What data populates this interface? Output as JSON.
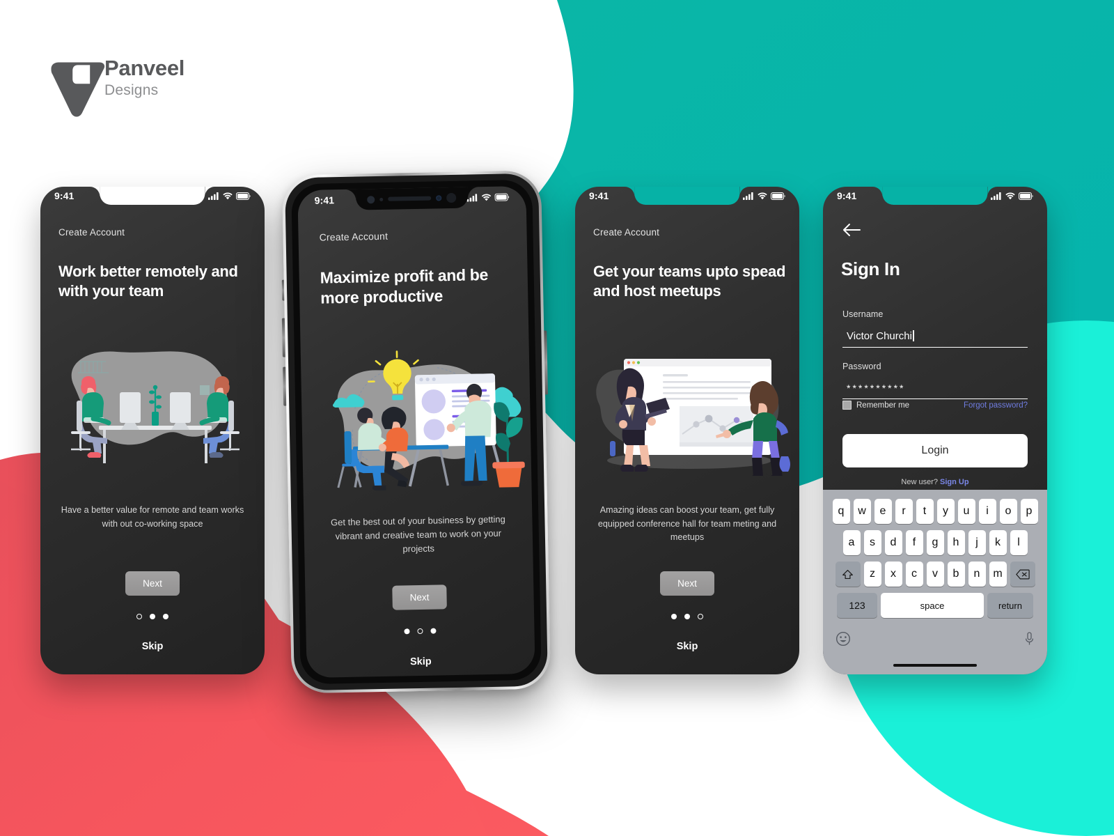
{
  "brand": {
    "name": "Panveel",
    "tagline": "Designs",
    "logo_icon": "triangle-logo-icon"
  },
  "palette": {
    "teal": "#06b2a6",
    "cyan": "#1af0d8",
    "coral": "#f5545c",
    "white": "#ffffff",
    "screen_dark": "#2f2f2f",
    "accent_link": "#6f7ce0",
    "keyboard_bg": "#abaeb4"
  },
  "status_bar": {
    "time": "9:41",
    "cellular_icon": "cellular-signal-icon",
    "wifi_icon": "wifi-icon",
    "battery_icon": "battery-icon"
  },
  "onboarding": [
    {
      "id": "screen-1",
      "eyebrow": "Create Account",
      "headline": "Work better remotely and with your team",
      "caption": "Have a better value for remote and team works with out co-working space",
      "next_label": "Next",
      "skip_label": "Skip",
      "active_dot": 0,
      "illustration": "two-people-at-desks-illustration"
    },
    {
      "id": "screen-2",
      "eyebrow": "Create Account",
      "headline": "Maximize profit and be more productive",
      "caption": "Get the best out of your business by getting vibrant and creative team to work on your projects",
      "next_label": "Next",
      "skip_label": "Skip",
      "active_dot": 1,
      "illustration": "team-presentation-whiteboard-illustration"
    },
    {
      "id": "screen-3",
      "eyebrow": "Create Account",
      "headline": "Get your teams upto spead and host meetups",
      "caption": "Amazing ideas can boost your team, get fully equipped conference hall for team meting and meetups",
      "next_label": "Next",
      "skip_label": "Skip",
      "active_dot": 2,
      "illustration": "conference-presentation-illustration"
    }
  ],
  "signin": {
    "back_icon": "back-arrow-icon",
    "title": "Sign In",
    "username_label": "Username",
    "username_value": "Victor Churchi",
    "username_placeholder": "Username",
    "password_label": "Password",
    "password_value": "**********",
    "password_placeholder": "Password",
    "remember_label": "Remember me",
    "remember_checked": false,
    "forgot_label": "Forgot password?",
    "login_label": "Login",
    "newuser_prefix": "New user? ",
    "signup_label": "Sign Up"
  },
  "keyboard": {
    "row1": [
      "q",
      "w",
      "e",
      "r",
      "t",
      "y",
      "u",
      "i",
      "o",
      "p"
    ],
    "row2": [
      "a",
      "s",
      "d",
      "f",
      "g",
      "h",
      "j",
      "k",
      "l"
    ],
    "row3": [
      "z",
      "x",
      "c",
      "v",
      "b",
      "n",
      "m"
    ],
    "shift_icon": "shift-up-icon",
    "backspace_icon": "backspace-icon",
    "numbers_label": "123",
    "space_label": "space",
    "return_label": "return",
    "emoji_icon": "emoji-smiley-icon",
    "mic_icon": "microphone-icon"
  }
}
